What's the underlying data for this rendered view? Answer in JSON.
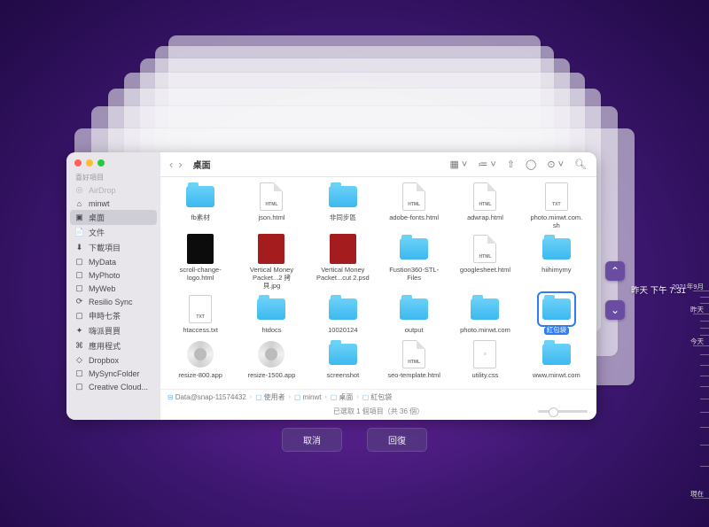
{
  "sidebar": {
    "section_fav": "喜好項目",
    "items": [
      {
        "label": "AirDrop",
        "icon": "airdrop-icon",
        "dim": true
      },
      {
        "label": "minwt",
        "icon": "home-icon"
      },
      {
        "label": "桌面",
        "icon": "desktop-icon",
        "selected": true
      },
      {
        "label": "文件",
        "icon": "doc-icon"
      },
      {
        "label": "下載項目",
        "icon": "download-icon"
      },
      {
        "label": "MyData",
        "icon": "folder-icon"
      },
      {
        "label": "MyPhoto",
        "icon": "folder-icon"
      },
      {
        "label": "MyWeb",
        "icon": "folder-icon"
      },
      {
        "label": "Resilio Sync",
        "icon": "sync-icon"
      },
      {
        "label": "申時七茶",
        "icon": "folder-icon"
      },
      {
        "label": "嗨派買買",
        "icon": "appstore-icon"
      },
      {
        "label": "應用程式",
        "icon": "apps-icon"
      },
      {
        "label": "Dropbox",
        "icon": "dropbox-icon"
      },
      {
        "label": "MySyncFolder",
        "icon": "folder-icon"
      },
      {
        "label": "Creative Cloud...",
        "icon": "folder-icon"
      }
    ]
  },
  "toolbar": {
    "title": "桌面"
  },
  "html_badge": "HTML",
  "txt_badge": "TXT",
  "items": [
    {
      "label": "fb素材",
      "type": "folder"
    },
    {
      "label": "json.html",
      "type": "html"
    },
    {
      "label": "非同步區",
      "type": "folder"
    },
    {
      "label": "adobe-fonts.html",
      "type": "html"
    },
    {
      "label": "adwrap.html",
      "type": "html"
    },
    {
      "label": "photo.minwt.com.sh",
      "type": "txt"
    },
    {
      "label": "scroll-change-logo.html",
      "type": "img-black"
    },
    {
      "label": "Vertical Money Packet...2 拷貝.jpg",
      "type": "img-red"
    },
    {
      "label": "Vertical Money Packet...cut 2.psd",
      "type": "img-red"
    },
    {
      "label": "Fustion360-STL-Files",
      "type": "folder"
    },
    {
      "label": "googlesheet.html",
      "type": "html"
    },
    {
      "label": "hiihimymy",
      "type": "folder"
    },
    {
      "label": "htaccess.txt",
      "type": "txt"
    },
    {
      "label": "htdocs",
      "type": "folder"
    },
    {
      "label": "10020124",
      "type": "folder"
    },
    {
      "label": "output",
      "type": "folder"
    },
    {
      "label": "photo.minwt.com",
      "type": "folder"
    },
    {
      "label": "紅包袋",
      "type": "folder",
      "selected": true
    },
    {
      "label": "resize-800.app",
      "type": "app"
    },
    {
      "label": "resize-1500.app",
      "type": "app"
    },
    {
      "label": "screenshot",
      "type": "folder"
    },
    {
      "label": "seo-template.html",
      "type": "html"
    },
    {
      "label": "utility.css",
      "type": "css"
    },
    {
      "label": "www.minwt.com",
      "type": "folder"
    }
  ],
  "path": {
    "crumbs": [
      "Data@snap-11574432",
      "使用者",
      "minwt",
      "桌面",
      "紅包袋"
    ]
  },
  "status": "已選取 1 個項目（共 36 個）",
  "snapshot_label": "昨天 下午 7:31",
  "timeline": {
    "t_sep": "2021年9月",
    "t_yest": "昨天",
    "t_today": "今天",
    "t_now": "現在"
  },
  "buttons": {
    "cancel": "取消",
    "restore": "回復"
  }
}
